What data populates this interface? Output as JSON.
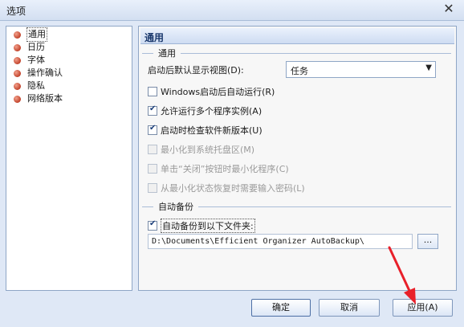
{
  "window": {
    "title": "选项",
    "close_glyph": "✕"
  },
  "sidebar": {
    "items": [
      {
        "label": "通用",
        "selected": true
      },
      {
        "label": "日历"
      },
      {
        "label": "字体"
      },
      {
        "label": "操作确认"
      },
      {
        "label": "隐私"
      },
      {
        "label": "网络版本"
      }
    ]
  },
  "panel": {
    "header": "通用",
    "general_group": "通用",
    "default_view_label": "启动后默认显示视图(D):",
    "default_view_value": "任务",
    "options": [
      {
        "label": "Windows启动后自动运行(R)",
        "checked": false,
        "enabled": true
      },
      {
        "label": "允许运行多个程序实例(A)",
        "checked": true,
        "enabled": true
      },
      {
        "label": "启动时检查软件新版本(U)",
        "checked": true,
        "enabled": true
      },
      {
        "label": "最小化到系统托盘区(M)",
        "checked": false,
        "enabled": false
      },
      {
        "label": "单击“关闭”按钮时最小化程序(C)",
        "checked": false,
        "enabled": false
      },
      {
        "label": "从最小化状态恢复时需要输入密码(L)",
        "checked": false,
        "enabled": false
      }
    ],
    "backup_group": "自动备份",
    "backup_checkbox": "自动备份到以下文件夹:",
    "backup_path": "D:\\Documents\\Efficient Organizer AutoBackup\\",
    "browse_label": "..."
  },
  "buttons": {
    "ok": "确定",
    "cancel": "取消",
    "apply": "应用(A)"
  },
  "colors": {
    "accent": "#1c3a6e",
    "annotation_arrow": "#e8202a"
  }
}
